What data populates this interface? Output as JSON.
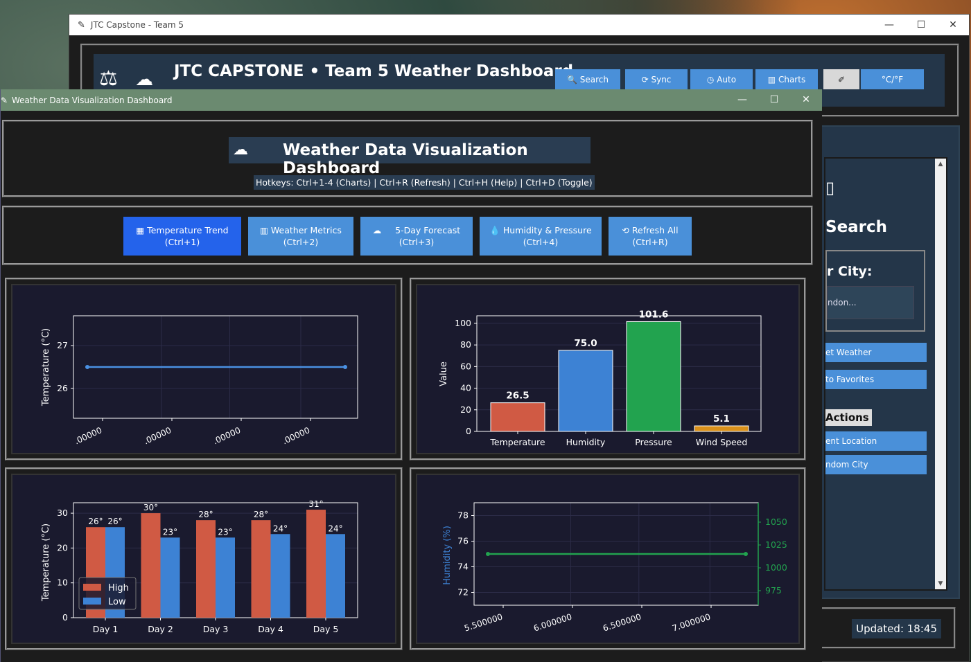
{
  "main_window": {
    "title": "JTC Capstone - Team 5",
    "header_title": "JTC CAPSTONE • Team 5 Weather Dashboard",
    "logo_icon": "scales-icon",
    "buttons": {
      "search": "Search",
      "sync": "Sync",
      "auto": "Auto",
      "charts": "Charts",
      "units": "°C/°F"
    },
    "sidebar": {
      "heading": "Search",
      "city_label": "r City:",
      "city_placeholder": "ndon...",
      "get_weather": "et Weather",
      "add_favorites": "to Favorites",
      "quick_actions": "Actions",
      "current_location": "ent Location",
      "random_city": "ndom City"
    },
    "updated": "Updated: 18:45"
  },
  "viz_window": {
    "title": "Weather Data Visualization Dashboard",
    "header_title": "Weather Data Visualization Dashboard",
    "hotkeys": "Hotkeys: Ctrl+1-4 (Charts) | Ctrl+R (Refresh) | Ctrl+H (Help) | Ctrl+D (Toggle)",
    "tabs": [
      {
        "label": "Temperature Trend",
        "hotkey": "(Ctrl+1)",
        "icon": "chart-icon"
      },
      {
        "label": "Weather Metrics",
        "hotkey": "(Ctrl+2)",
        "icon": "bar-chart-icon"
      },
      {
        "label": "5-Day Forecast",
        "hotkey": "(Ctrl+3)",
        "icon": "cloud-sun-icon"
      },
      {
        "label": "Humidity & Pressure",
        "hotkey": "(Ctrl+4)",
        "icon": "droplet-icon"
      },
      {
        "label": "Refresh All",
        "hotkey": "(Ctrl+R)",
        "icon": "refresh-icon"
      }
    ]
  },
  "colors": {
    "accent": "#4a90d9",
    "active_tab": "#2463eb",
    "chart_bg": "#1a1a2e",
    "temp_line": "#4a90e2",
    "red": "#d05a44",
    "blue": "#3d82d4",
    "green": "#22a34f",
    "orange": "#d9901a"
  },
  "chart_data": [
    {
      "type": "line",
      "ylabel": "Temperature (°C)",
      "yticks": [
        26,
        27
      ],
      "ylim": [
        25.3,
        27.7
      ],
      "xticklabels": [
        ".00000",
        ".00000",
        ".00000",
        ".00000"
      ],
      "series": [
        {
          "values": [
            26.5,
            26.5
          ]
        }
      ]
    },
    {
      "type": "bar",
      "ylabel": "Value",
      "categories": [
        "Temperature",
        "Humidity",
        "Pressure",
        "Wind Speed"
      ],
      "values": [
        26.5,
        75.0,
        101.6,
        5.1
      ],
      "value_labels": [
        "26.5",
        "75.0",
        "101.6",
        "5.1"
      ],
      "yticks": [
        0,
        20,
        40,
        60,
        80,
        100
      ],
      "ylim": [
        0,
        107
      ]
    },
    {
      "type": "bar",
      "ylabel": "Temperature (°C)",
      "categories": [
        "Day 1",
        "Day 2",
        "Day 3",
        "Day 4",
        "Day 5"
      ],
      "series": [
        {
          "name": "High",
          "values": [
            26,
            30,
            28,
            28,
            31
          ],
          "labels": [
            "26°",
            "30°",
            "28°",
            "28°",
            "31°"
          ]
        },
        {
          "name": "Low",
          "values": [
            26,
            23,
            23,
            24,
            24
          ],
          "labels": [
            "26°",
            "23°",
            "23°",
            "24°",
            "24°"
          ]
        }
      ],
      "yticks": [
        0,
        10,
        20,
        30
      ],
      "ylim": [
        0,
        33
      ]
    },
    {
      "type": "line",
      "ylabel": "Humidity (%)",
      "yticks": [
        72,
        74,
        76,
        78
      ],
      "ylim": [
        71,
        79
      ],
      "y2ticks": [
        975,
        1000,
        1025,
        1050
      ],
      "xticklabels": [
        "5.500000",
        "6.000000",
        "6.500000",
        "7.000000"
      ],
      "series": [
        {
          "values": [
            75,
            75
          ]
        }
      ]
    }
  ]
}
